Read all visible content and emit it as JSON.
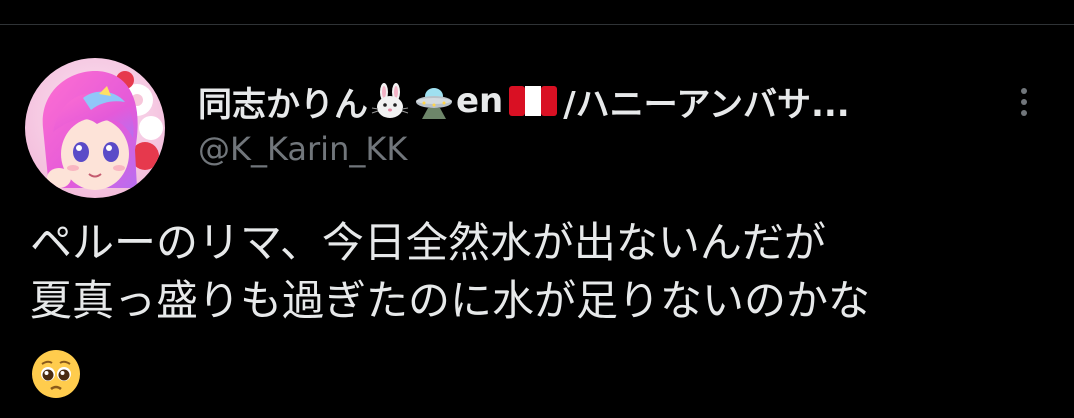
{
  "tweet": {
    "author": {
      "name_start": "同志かりん",
      "name_mid": "en",
      "name_end": "/ハニーアンバサ...",
      "handle": "@K_Karin_KK",
      "name_emoji": [
        "rabbit-emoji",
        "ufo-emoji",
        "peru-flag-emoji"
      ],
      "avatar_icon": "avatar-image"
    },
    "text_lines": [
      "ペルーのリマ、今日全然水が出ないんだが",
      "夏真っ盛りも過ぎたのに水が足りないのかな"
    ],
    "trailing_emoji": "pleading-face-emoji",
    "more_icon": "more-vertical-icon"
  },
  "colors": {
    "background": "#000000",
    "text_primary": "#e7e9ea",
    "text_secondary": "#71767b",
    "divider": "#2f3336",
    "flag_red": "#d91023"
  }
}
